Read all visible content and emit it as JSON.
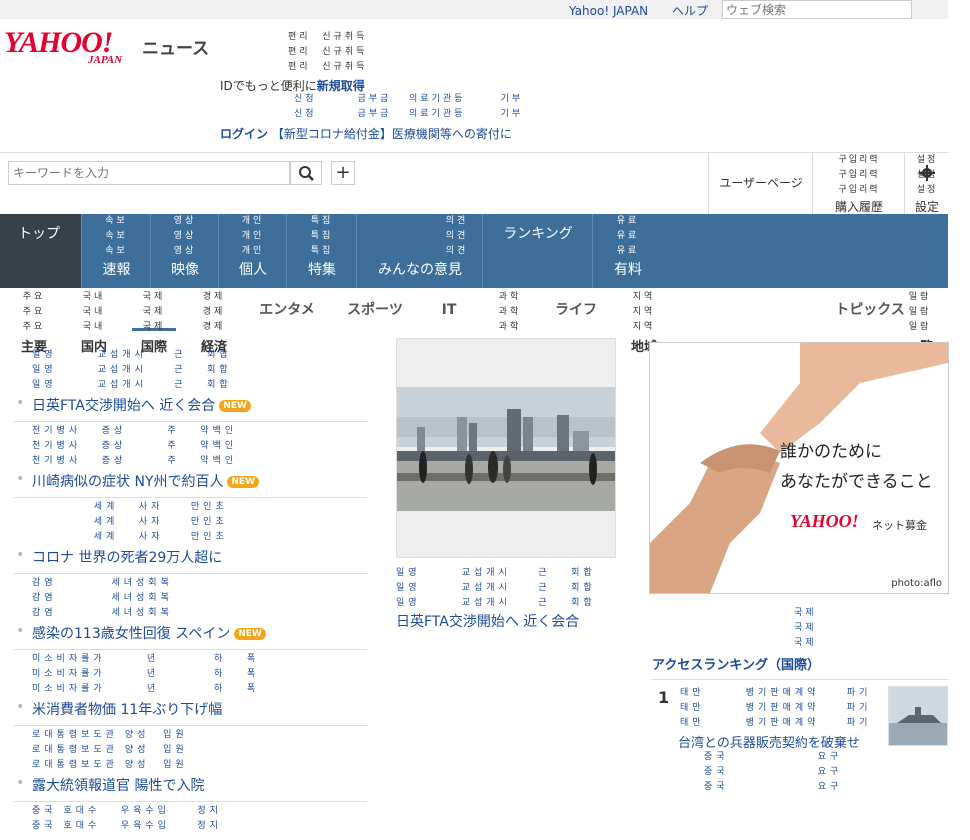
{
  "header": {
    "links": [
      "Yahoo! JAPAN",
      "ヘルプ"
    ],
    "web_search_placeholder": "ウェブ検索",
    "logo_main": "YAHOO!",
    "logo_sub": "JAPAN",
    "section_name": "ニュース",
    "kor_lines": "편리  신규취득\n편리  신규취득\n편리  신규취득",
    "id_prefix": "IDでもっと便利に",
    "id_link": "新規取得",
    "kor_lines2": "신청       금부금   의료기관등      기부\n신청       금부금   의료기관등      기부",
    "login_link": "ログイン",
    "login_text": "【新型コロナ給付金】医療機関等への寄付に"
  },
  "search": {
    "placeholder": "キーワードを入力",
    "user_page": "ユーザーページ",
    "purchase_kor": "구입리력\n구입리력\n구입리력",
    "purchase_label": "購入履歴",
    "settings_kor": "설정\n설정\n설정",
    "settings_label": "設定"
  },
  "main_nav": [
    {
      "kor": "",
      "label": "トップ"
    },
    {
      "kor": "속보\n속보\n속보",
      "label": "速報"
    },
    {
      "kor": "영상\n영상\n영상",
      "label": "映像"
    },
    {
      "kor": "개인\n개인\n개인",
      "label": "個人"
    },
    {
      "kor": "특집\n특집\n특집",
      "label": "特集"
    },
    {
      "kor": "의견\n의견\n의견",
      "label": "みんなの意見"
    },
    {
      "kor": "",
      "label": "ランキング"
    },
    {
      "kor": "유료\n유료\n유료",
      "label": "有料"
    }
  ],
  "sub_nav": [
    {
      "kor": "주요\n주요\n주요",
      "label": "主要"
    },
    {
      "kor": "국내\n국내\n국내",
      "label": "国内"
    },
    {
      "kor": "국제\n국제\n국제",
      "label": "国際"
    },
    {
      "kor": "경제\n경제\n경제",
      "label": "経済"
    },
    {
      "kor": "",
      "label": "エンタメ"
    },
    {
      "kor": "",
      "label": "スポーツ"
    },
    {
      "kor": "",
      "label": "IT"
    },
    {
      "kor": "과학\n과학\n과학",
      "label": ""
    },
    {
      "kor": "",
      "label": "ライフ"
    },
    {
      "kor": "지역\n지역\n지역",
      "label": "地域"
    },
    {
      "kor": "",
      "label": "トピックス"
    },
    {
      "kor": "일람\n일람\n일람",
      "label": "一覧"
    }
  ],
  "articles": [
    {
      "kor": "일영      교섭개시    근   회합\n일영      교섭개시    근   회합\n일영      교섭개시    근   회합",
      "title": "日英FTA交渉開始へ 近く会合",
      "badge": "NEW"
    },
    {
      "kor": "천기병사   증상      주   약백인\n천기병사   증상      주   약백인\n천기병사   증상      주   약백인",
      "title": "川崎病似の症状 NY州で約百人",
      "badge": "NEW"
    },
    {
      "kor": "         세계   사자    만인초\n         세계   사자    만인초\n         세계   사자    만인초",
      "title": "コロナ 世界の死者29万人超に",
      "badge": ""
    },
    {
      "kor": "감염        세녀성회복\n감염        세녀성회복\n감염        세녀성회복",
      "title": "感染の113歳女性回復 スペイン",
      "badge": "NEW"
    },
    {
      "kor": "미소비자률가      년        하   폭\n미소비자률가      년        하   폭\n미소비자률가      년        하   폭",
      "title": "米消費者物価 11年ぶり下げ幅",
      "badge": ""
    },
    {
      "kor": "로대통령보도관 양성  입원\n로대통령보도관 양성  입원\n로대통령보도관 양성  입원",
      "title": "露大統領報道官 陽性で入院",
      "badge": ""
    },
    {
      "kor": "중국 호대수   우육수입    정지\n중국 호대수   우육수입    정지",
      "title": "",
      "badge": ""
    }
  ],
  "photo_article": {
    "kor": "일영      교섭개시    근   회합\n일영      교섭개시    근   회합\n일영      교섭개시    근   회합",
    "title": "日英FTA交渉開始へ 近く会合"
  },
  "ad": {
    "line1": "誰かのために",
    "line2": "あなたができること",
    "logo": "YAHOO!",
    "logo_sub": "ネット募金",
    "credit": "photo:aflo"
  },
  "ranking": {
    "head_kor": "국제\n국제\n국제",
    "title": "アクセスランキング（国際）",
    "items": [
      {
        "num": "1",
        "kor": "태만      병기판매계약    파기\n태만      병기판매계약    파기\n태만      병기판매계약    파기",
        "title": "台湾との兵器販売契約を破棄せ"
      }
    ],
    "next_kor": "중국             요구\n중국             요구\n중국             요구"
  },
  "colors": {
    "nav_bg": "#3e6f9a",
    "nav_active": "#38424b",
    "link": "#1d4b99",
    "brand_red": "#e6002d",
    "badge": "#f3a619"
  }
}
